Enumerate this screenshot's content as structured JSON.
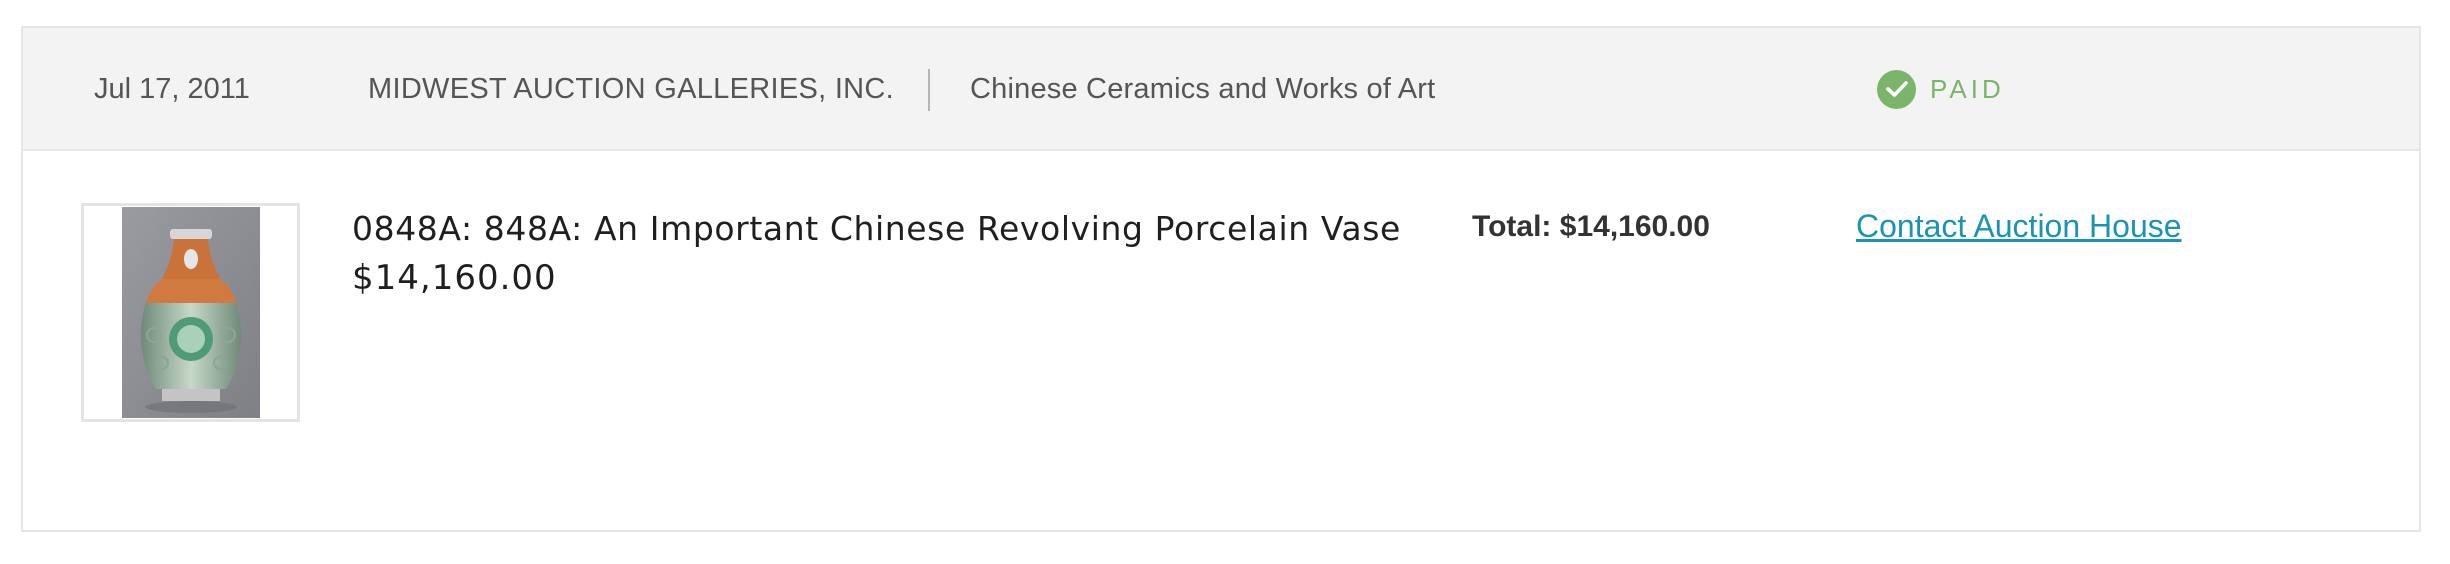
{
  "invoice": {
    "date": "Jul 17, 2011",
    "auction_house": "MIDWEST AUCTION GALLERIES, INC.",
    "sale_title": "Chinese Ceramics and Works of Art",
    "status": {
      "label": "PAID",
      "icon": "check-circle-icon",
      "color": "#7ab56a"
    }
  },
  "lot": {
    "image": "vase-image",
    "title": "0848A: 848A: An Important Chinese Revolving Porcelain Vase",
    "price": "$14,160.00"
  },
  "summary": {
    "total": "Total: $14,160.00",
    "contact_link": "Contact Auction House",
    "link_color": "#1b93b8"
  }
}
